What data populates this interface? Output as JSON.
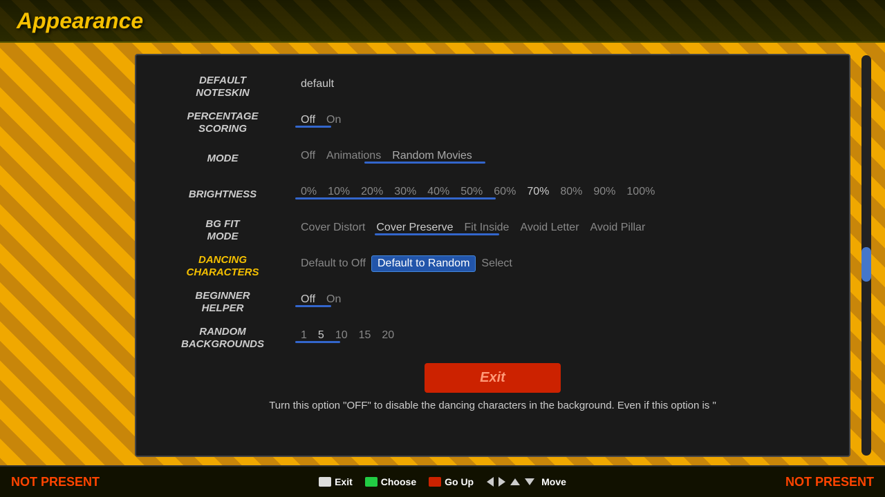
{
  "header": {
    "title": "Appearance"
  },
  "settings": {
    "rows": [
      {
        "id": "default-noteskin",
        "label": "DEFAULT\nNOTESKIN",
        "options": [
          "default"
        ],
        "selected": "default",
        "slider_pos": null
      },
      {
        "id": "percentage-scoring",
        "label": "PERCENTAGE\nSCORING",
        "options": [
          "Off",
          "On"
        ],
        "selected": "Off",
        "slider_pos": "left"
      },
      {
        "id": "mode",
        "label": "MODE",
        "options": [
          "Off",
          "Animations",
          "Random Movies"
        ],
        "selected": "Random Movies",
        "slider_pos": "right"
      },
      {
        "id": "brightness",
        "label": "BRIGHTNESS",
        "options": [
          "0%",
          "10%",
          "20%",
          "30%",
          "40%",
          "50%",
          "60%",
          "70%",
          "80%",
          "90%",
          "100%"
        ],
        "selected": "70%",
        "slider_pos": "70pct"
      },
      {
        "id": "bg-fit-mode",
        "label": "BG FIT\nMODE",
        "options": [
          "Cover Distort",
          "Cover Preserve",
          "Fit Inside",
          "Avoid Letter",
          "Avoid Pillar"
        ],
        "selected": "Cover Preserve",
        "slider_pos": "mid-left"
      },
      {
        "id": "dancing-characters",
        "label": "DANCING\nCHARACTERS",
        "label_highlighted": true,
        "options": [
          "Default to Off",
          "Default to Random",
          "Select"
        ],
        "selected": "Default to Random",
        "slider_pos": null
      },
      {
        "id": "beginner-helper",
        "label": "BEGINNER\nHELPER",
        "options": [
          "Off",
          "On"
        ],
        "selected": "Off",
        "slider_pos": "left"
      },
      {
        "id": "random-backgrounds",
        "label": "RANDOM\nBACKGROUNDS",
        "options": [
          "1",
          "5",
          "10",
          "15",
          "20"
        ],
        "selected": "5",
        "slider_pos": "left"
      }
    ]
  },
  "exit_button": {
    "label": "Exit"
  },
  "description": {
    "text": "Turn this option \"OFF\" to disable the dancing characters in the background.\nEven if this option is \""
  },
  "bottom_bar": {
    "left": "NOT PRESENT",
    "right": "NOT PRESENT",
    "controls": [
      {
        "icon": "white",
        "label": "Exit"
      },
      {
        "icon": "green",
        "label": "Choose"
      },
      {
        "icon": "red",
        "label": "Go Up"
      },
      {
        "label_arrows": "◄ ►"
      },
      {
        "label_arrows2": "▲ ▼"
      },
      {
        "label": "Move"
      }
    ]
  }
}
